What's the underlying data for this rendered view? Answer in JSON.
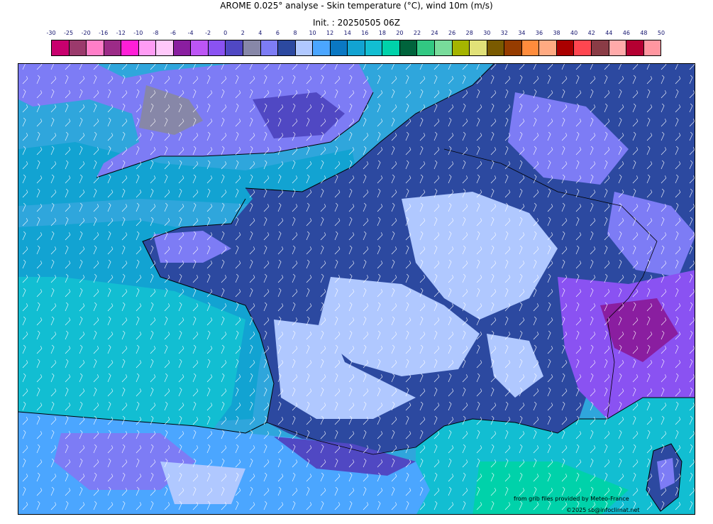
{
  "title": "AROME 0.025° analyse - Skin temperature (°C), wind 10m (m/s)",
  "init": "Init. : 20250505 06Z",
  "colorbar": {
    "ticks": [
      "-30",
      "-25",
      "-20",
      "-16",
      "-12",
      "-10",
      "-8",
      "-6",
      "-4",
      "-2",
      "0",
      "2",
      "4",
      "6",
      "8",
      "10",
      "12",
      "14",
      "16",
      "18",
      "20",
      "22",
      "24",
      "26",
      "28",
      "30",
      "32",
      "34",
      "36",
      "38",
      "40",
      "42",
      "44",
      "46",
      "48",
      "50"
    ],
    "colors": [
      "#c8006e",
      "#9b3a6c",
      "#ff7ec8",
      "#9c2b87",
      "#ff1fd7",
      "#ff9cf4",
      "#ffc8fa",
      "#8a1ea0",
      "#bd55f5",
      "#8a52f2",
      "#5048c3",
      "#8787a8",
      "#7d7cf5",
      "#2c49a0",
      "#b0c8ff",
      "#4ba6ff",
      "#0a78c3",
      "#12a3d2",
      "#12bed2",
      "#00d2aa",
      "#00643c",
      "#32c882",
      "#78dc9b",
      "#a5b400",
      "#e1e178",
      "#7a5a00",
      "#963c00",
      "#ff8c3c",
      "#ffaa82",
      "#aa0000",
      "#ff4650",
      "#8a3c46",
      "#ffaaaa",
      "#b40032",
      "#ff96a0"
    ]
  },
  "map": {
    "sea_color": "#2fa6dc",
    "land_cool_color": "#2c49a0",
    "land_mild_color": "#b0c8ff",
    "land_cold_color": "#7d7cf5",
    "alps_color": "#8a52f2",
    "med_sea_color": "#12bed2"
  },
  "credits": {
    "source": "from grib files provided by Meteo-France",
    "copyright": "©2025 sb@infoclimat.net"
  }
}
